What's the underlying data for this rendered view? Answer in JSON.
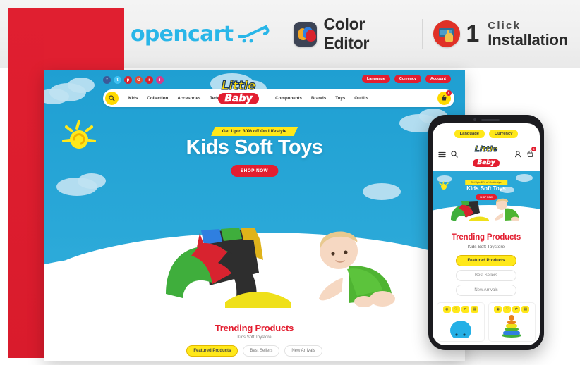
{
  "header": {
    "opencart": {
      "wordmark": "opencart",
      "cart_icon": "shopping-cart-icon"
    },
    "color_editor": {
      "label": "Color Editor",
      "icon": "color-droplets-icon"
    },
    "one_click": {
      "number": "1",
      "line1": "Click",
      "line2": "Installation",
      "icon": "cursor-click-icon"
    }
  },
  "desktop": {
    "socials": [
      {
        "name": "facebook",
        "glyph": "f",
        "color": "#3b5998"
      },
      {
        "name": "twitter",
        "glyph": "t",
        "color": "#3fc1f2"
      },
      {
        "name": "pinterest",
        "glyph": "p",
        "color": "#d8232f"
      },
      {
        "name": "google-plus",
        "glyph": "G",
        "color": "#dd4b39"
      },
      {
        "name": "rss",
        "glyph": "r",
        "color": "#d8232f"
      },
      {
        "name": "instagram",
        "glyph": "i",
        "color": "#d63b8b"
      }
    ],
    "topbar_buttons": [
      "Language",
      "Currency",
      "Account"
    ],
    "nav_items": [
      "Kids",
      "Collection",
      "Accesories",
      "Teddy",
      "Components",
      "Brands",
      "Toys",
      "Outfits"
    ],
    "cart_count": "0",
    "logo": {
      "line1": "Little",
      "line2": "Baby"
    },
    "hero": {
      "tag_prefix": "Get Upto ",
      "tag_strong": "30%",
      "tag_suffix": " off On Lifestyle",
      "title": "Kids Soft Toys",
      "button": "SHOP NOW"
    },
    "slider_dots": [
      "dot-1",
      "dot-2"
    ],
    "trending": {
      "title": "Trending Products",
      "subtitle": "Kids Soft Toystore",
      "tabs": [
        "Featured Products",
        "Best Sellers",
        "New Arrivals"
      ],
      "active_tab": "Featured Products"
    }
  },
  "mobile": {
    "topbar_buttons": [
      "Language",
      "Currency"
    ],
    "logo": {
      "line1": "Little",
      "line2": "Baby"
    },
    "cart_count": "0",
    "hero": {
      "tag": "Get Upto 30% off On Lifestyle",
      "title": "Kids Soft Toys",
      "button": "SHOP NOW"
    },
    "trending": {
      "title": "Trending Products",
      "subtitle": "Kids Soft Toystore",
      "tabs": [
        "Featured Products",
        "Best Sellers",
        "New Arrivals"
      ],
      "active_tab": "Featured Products"
    },
    "card_actions": [
      "◉",
      "♡",
      "⇄",
      "▤"
    ]
  },
  "colors": {
    "brand_red": "#e31e30",
    "brand_yellow": "#ffe81a",
    "sky_blue": "#2aa8d8",
    "opencart_blue": "#29b6e8"
  }
}
